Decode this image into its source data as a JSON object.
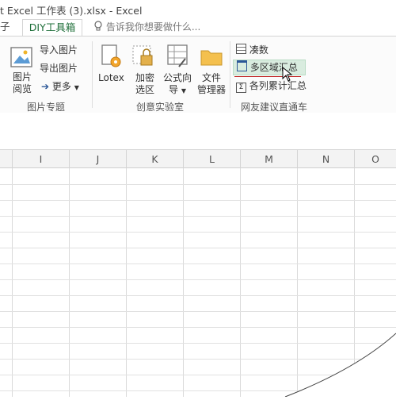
{
  "window": {
    "title": "t Excel 工作表 (3).xlsx - Excel"
  },
  "tabs": {
    "partial_tab": "子",
    "active_tab": "DIY工具箱"
  },
  "tell_me": {
    "placeholder": "告诉我你想要做什么..."
  },
  "ribbon": {
    "group_picture": {
      "label": "图片专题",
      "picture_view_line1": "图片",
      "picture_view_line2": "阅览",
      "import_picture": "导入图片",
      "export_picture": "导出图片",
      "more": "更多"
    },
    "group_creative": {
      "label": "创意实验室",
      "lotex": "Lotex",
      "encrypt_line1": "加密",
      "encrypt_line2": "选区",
      "formula_line1": "公式向",
      "formula_line2": "导",
      "file_line1": "文件",
      "file_line2": "管理器"
    },
    "group_netfriend": {
      "label": "网友建议直通车",
      "collect_count": "凑数",
      "multi_region_sum": "多区域汇总",
      "column_cumulative_sum": "各列累计汇总"
    }
  },
  "sheet": {
    "columns": [
      "I",
      "J",
      "K",
      "L",
      "M",
      "N",
      "O"
    ]
  },
  "colors": {
    "accent_green": "#217346",
    "highlight": "#d9ecdf"
  }
}
